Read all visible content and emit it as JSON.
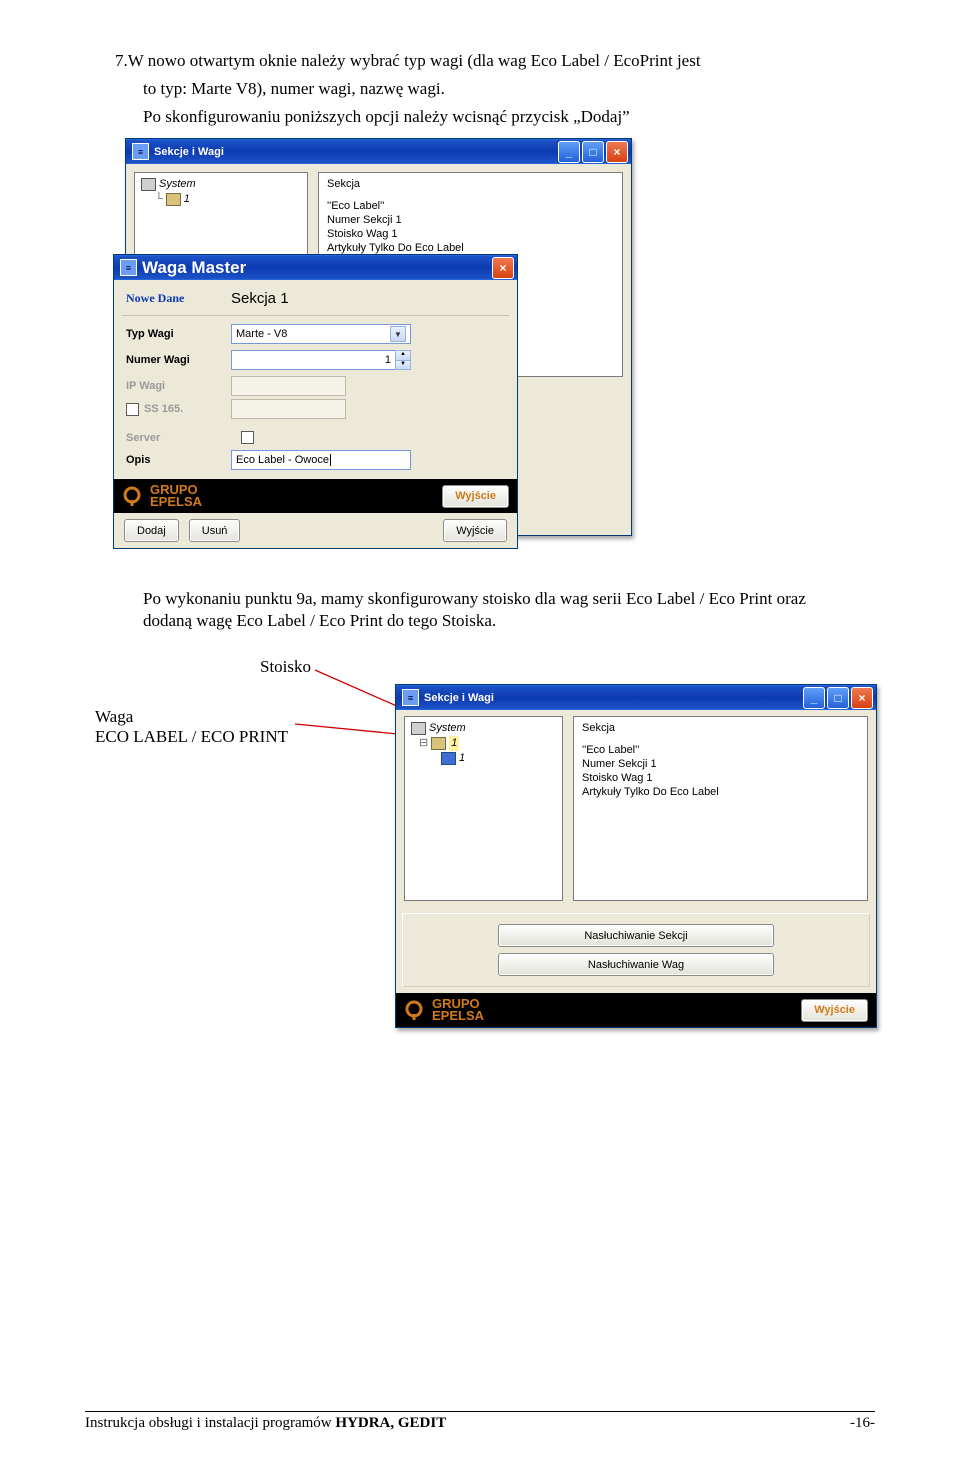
{
  "doc": {
    "step7_a": "7.W nowo otwartym oknie należy wybrać typ wagi (dla wag Eco Label / EcoPrint  jest",
    "step7_b": "to typ: Marte V8), numer wagi, nazwę wagi.",
    "step7_c": "Po skonfigurowaniu poniższych opcji należy wcisnąć przycisk „Dodaj”",
    "post": "Po wykonaniu punktu 9a, mamy skonfigurowany stoisko dla wag serii Eco Label / Eco Print oraz dodaną wagę Eco Label /  Eco Print do tego Stoiska.",
    "label_stoisko": "Stoisko",
    "label_waga1": "Waga",
    "label_waga2": "ECO LABEL / ECO PRINT",
    "footer_left": "Instrukcja obsługi i instalacji programów HYDRA, GEDIT",
    "footer_right": "-16-"
  },
  "win1": {
    "title": "Sekcje i Wagi",
    "tree_root": " System",
    "tree_item": "1",
    "info_h": "Sekcja",
    "info_l1": "''Eco Label''",
    "info_l2": "Numer Sekcji 1",
    "info_l3": "Stoisko Wag 1",
    "info_l4": "Artykuły Tylko Do Eco Label"
  },
  "modal": {
    "title": "Waga Master",
    "nowe": "Nowe Dane",
    "sekcja": "Sekcja 1",
    "lbl_typ": "Typ Wagi",
    "val_typ": "Marte - V8",
    "lbl_num": "Numer Wagi",
    "val_num": "1",
    "lbl_ip": "IP Wagi",
    "lbl_ss": "SS 165.",
    "lbl_server": "Server",
    "lbl_opis": "Opis",
    "val_opis": "Eco Label - Owoce",
    "brand1": "GRUPO",
    "brand2": "EPELSA",
    "btn_dodaj": "Dodaj",
    "btn_usun": "Usuń",
    "btn_wyj": "Wyjście"
  },
  "win2": {
    "title": "Sekcje i Wagi",
    "tree_root": " System",
    "tree_child": "1",
    "tree_leaf": "1",
    "info_h": "Sekcja",
    "info_l1": "''Eco Label''",
    "info_l2": "Numer Sekcji 1",
    "info_l3": "Stoisko Wag 1",
    "info_l4": "Artykuły Tylko Do Eco Label",
    "btn_nasek": "Nasłuchiwanie Sekcji",
    "btn_naswag": "Nasłuchiwanie Wag",
    "brand1": "GRUPO",
    "brand2": "EPELSA",
    "btn_wyj": "Wyjście"
  }
}
